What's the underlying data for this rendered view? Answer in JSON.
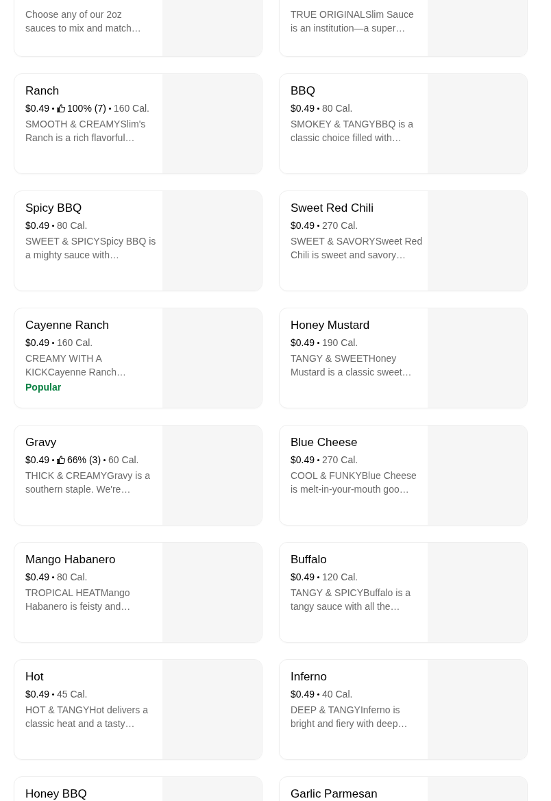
{
  "items": [
    {
      "description": "Choose any of our 2oz\nsauces to mix and match…"
    },
    {
      "description": "TRUE ORIGINALSlim Sauce\nis an institution—a super…"
    },
    {
      "name": "Ranch",
      "price": "$0.49",
      "rating": "100% (7)",
      "calories": "160 Cal.",
      "description": "SMOOTH & CREAMYSlim's\nRanch is a rich flavorful…"
    },
    {
      "name": "BBQ",
      "price": "$0.49",
      "calories": "80 Cal.",
      "description": "SMOKEY & TANGYBBQ is a\nclassic choice filled with…"
    },
    {
      "name": "Spicy BBQ",
      "price": "$0.49",
      "calories": "80 Cal.",
      "description": "SWEET & SPICYSpicy BBQ is\na mighty sauce with…"
    },
    {
      "name": "Sweet Red Chili",
      "price": "$0.49",
      "calories": "270 Cal.",
      "description": "SWEET & SAVORYSweet Red\nChili is sweet and savory…"
    },
    {
      "name": "Cayenne Ranch",
      "price": "$0.49",
      "calories": "160 Cal.",
      "description": "CREAMY WITH A\nKICKCayenne Ranch…",
      "badge": "Popular"
    },
    {
      "name": "Honey Mustard",
      "price": "$0.49",
      "calories": "190 Cal.",
      "description": "TANGY & SWEETHoney\nMustard is a classic sweet…"
    },
    {
      "name": "Gravy",
      "price": "$0.49",
      "rating": "66% (3)",
      "calories": "60 Cal.",
      "description": "THICK & CREAMYGravy is a\nsouthern staple. We're…"
    },
    {
      "name": "Blue Cheese",
      "price": "$0.49",
      "calories": "270 Cal.",
      "description": "COOL & FUNKYBlue Cheese\nis melt-in-your-mouth goo…"
    },
    {
      "name": "Mango Habanero",
      "price": "$0.49",
      "calories": "80 Cal.",
      "description": "TROPICAL HEATMango\nHabanero is feisty and…"
    },
    {
      "name": "Buffalo",
      "price": "$0.49",
      "calories": "120 Cal.",
      "description": "TANGY & SPICYBuffalo is a\ntangy sauce with all the…"
    },
    {
      "name": "Hot",
      "price": "$0.49",
      "calories": "45 Cal.",
      "description": "HOT & TANGYHot delivers a\nclassic heat and a tasty…"
    },
    {
      "name": "Inferno",
      "price": "$0.49",
      "calories": "40 Cal.",
      "description": "DEEP & TANGYInferno is\nbright and fiery with deep…"
    },
    {
      "name": "Honey BBQ"
    },
    {
      "name": "Garlic Parmesan"
    }
  ]
}
